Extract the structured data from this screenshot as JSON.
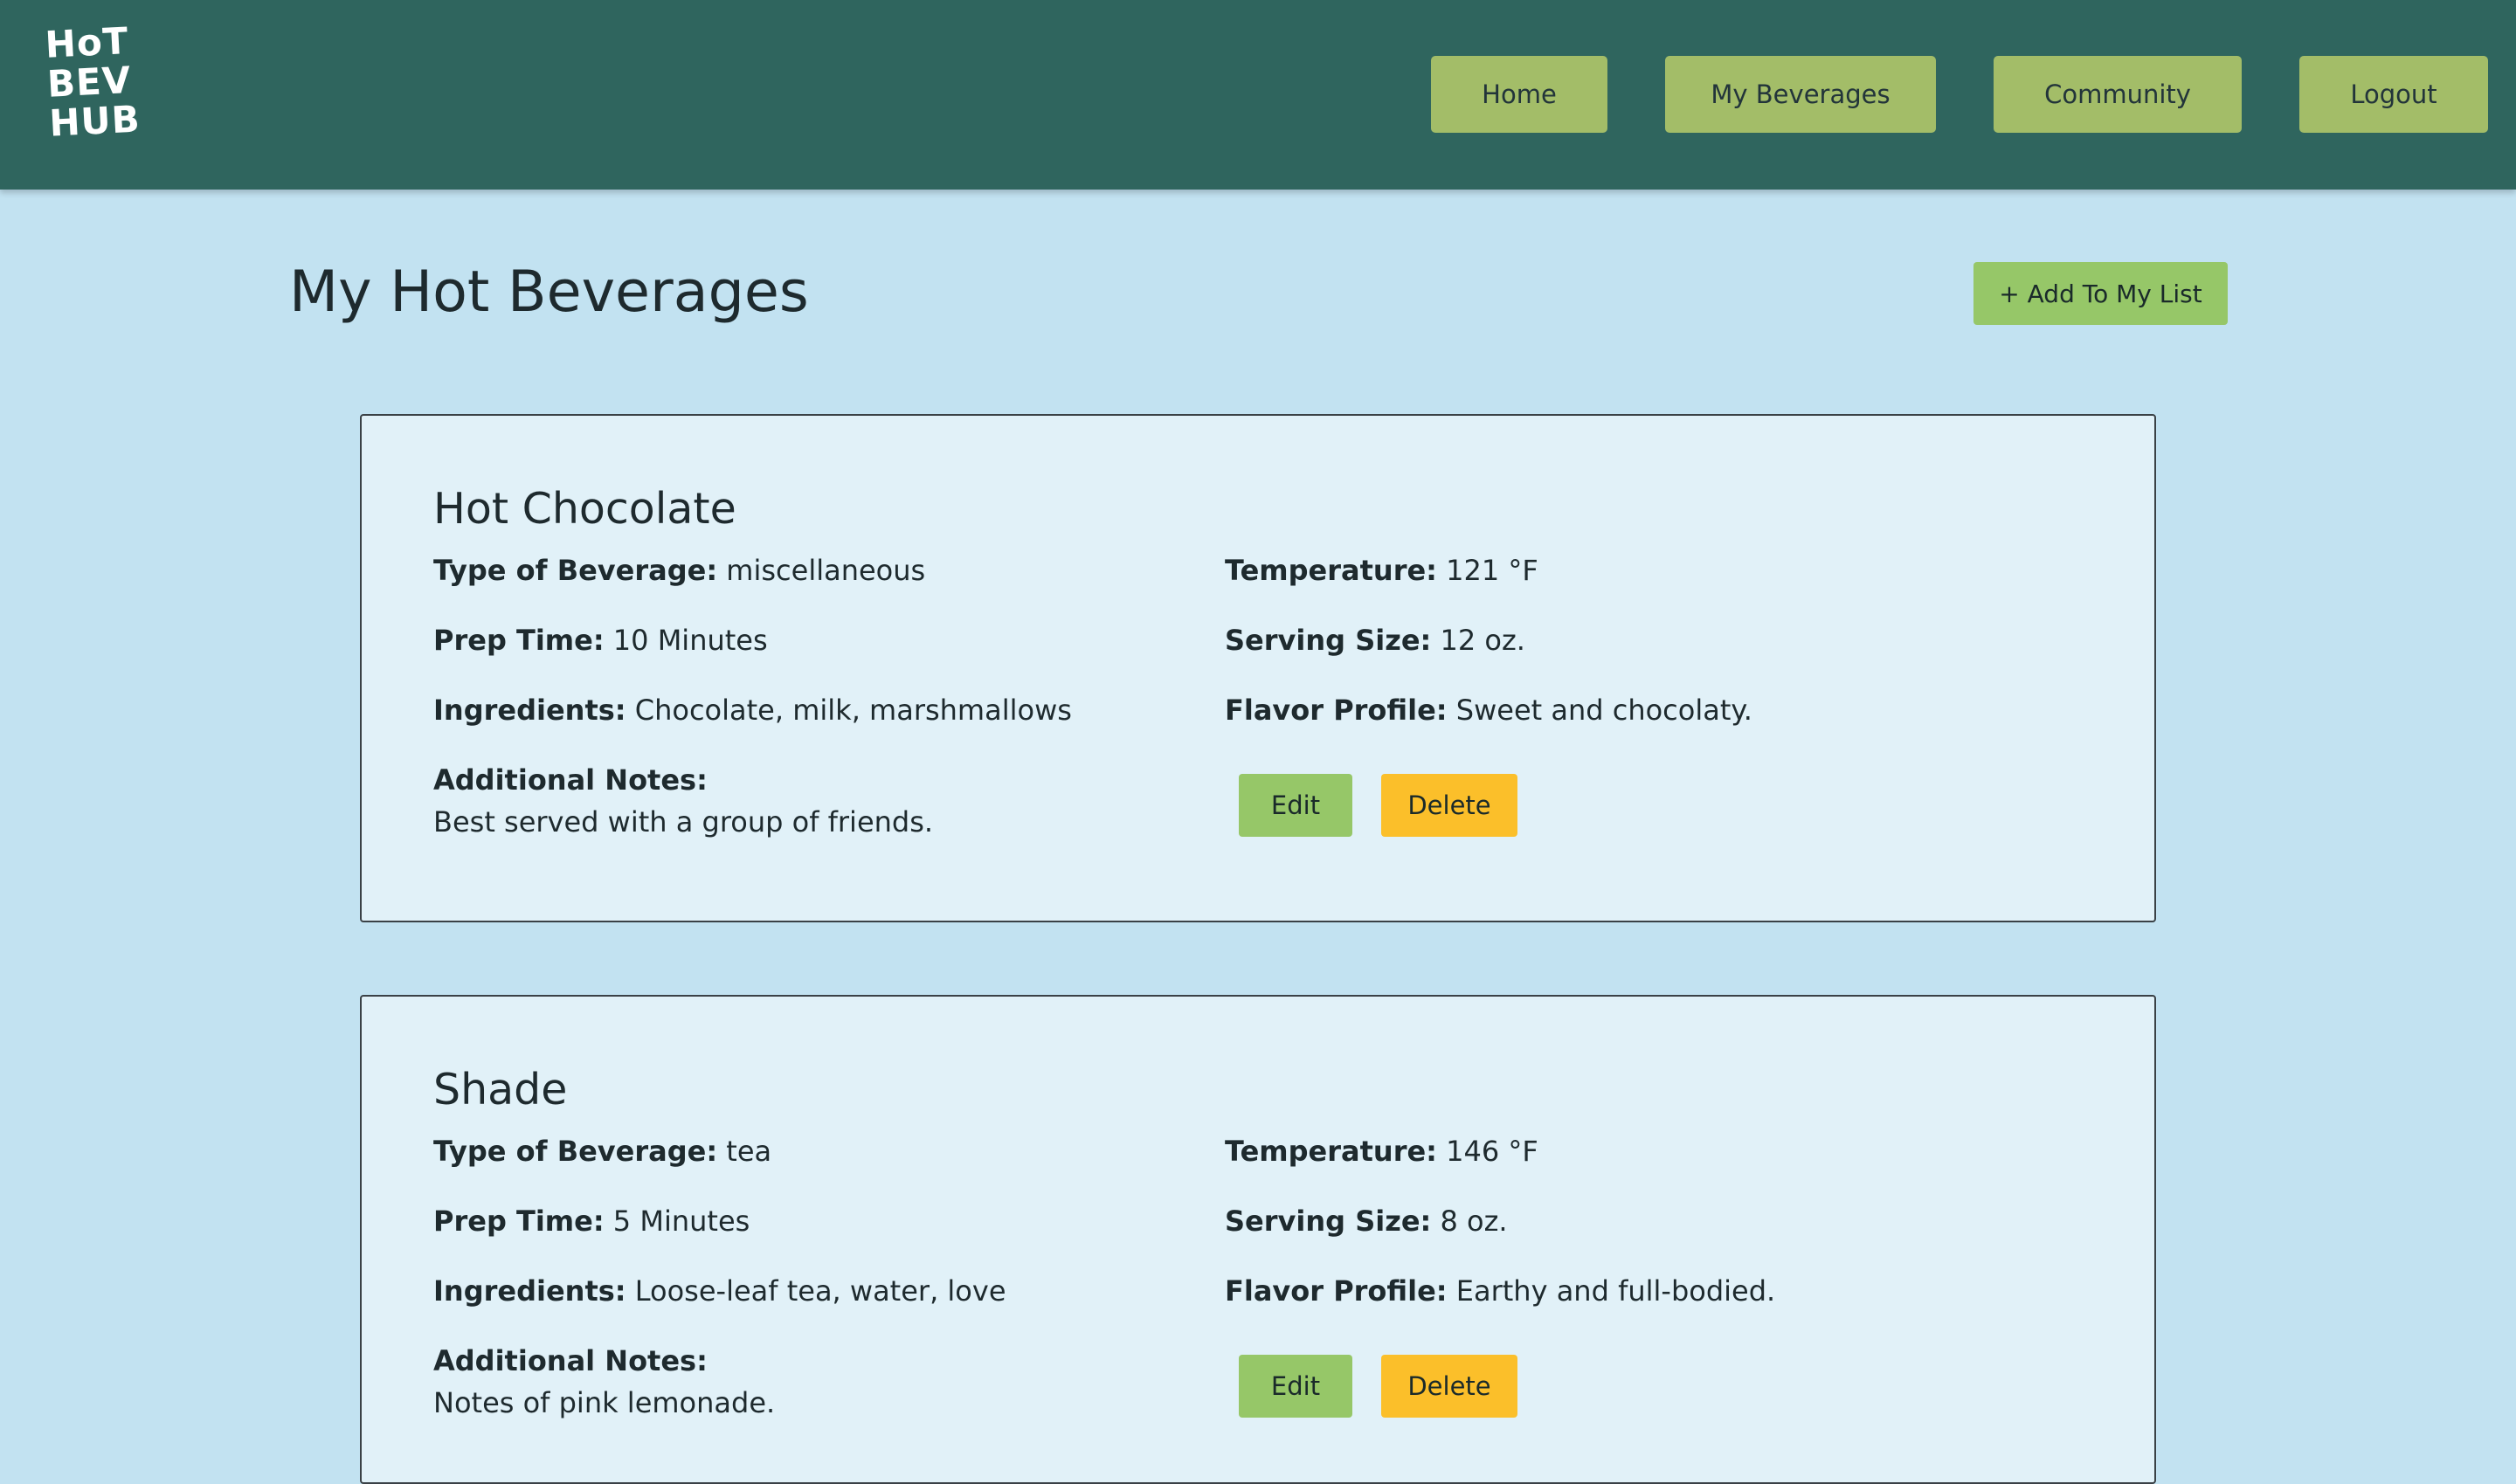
{
  "header": {
    "logo_lines": [
      "HoT",
      "BEV",
      "HUB"
    ],
    "nav": {
      "home": "Home",
      "my_beverages": "My Beverages",
      "community": "Community",
      "logout": "Logout"
    }
  },
  "main": {
    "title": "My Hot Beverages",
    "add_button": "+ Add To My List"
  },
  "labels": {
    "type": "Type of Beverage:",
    "temperature": "Temperature:",
    "prep_time": "Prep Time:",
    "serving_size": "Serving Size:",
    "ingredients": "Ingredients:",
    "flavor_profile": "Flavor Profile:",
    "notes": "Additional Notes:",
    "edit": "Edit",
    "delete": "Delete"
  },
  "beverages": [
    {
      "name": "Hot Chocolate",
      "type": "miscellaneous",
      "temperature": "121 °F",
      "prep_time": "10 Minutes",
      "serving_size": "12 oz.",
      "ingredients": "Chocolate, milk, marshmallows",
      "flavor_profile": "Sweet and chocolaty.",
      "notes": "Best served with a group of friends."
    },
    {
      "name": "Shade",
      "type": "tea",
      "temperature": "146 °F",
      "prep_time": "5 Minutes",
      "serving_size": "8 oz.",
      "ingredients": "Loose-leaf tea, water, love",
      "flavor_profile": "Earthy and full-bodied.",
      "notes": "Notes of pink lemonade."
    }
  ],
  "colors": {
    "navbar": "#2f655e",
    "nav_button": "#a3bd68",
    "page_background": "#c2e2f1",
    "card_background": "#e1f1f8",
    "edit_button": "#96c768",
    "delete_button": "#fbbf2a"
  }
}
